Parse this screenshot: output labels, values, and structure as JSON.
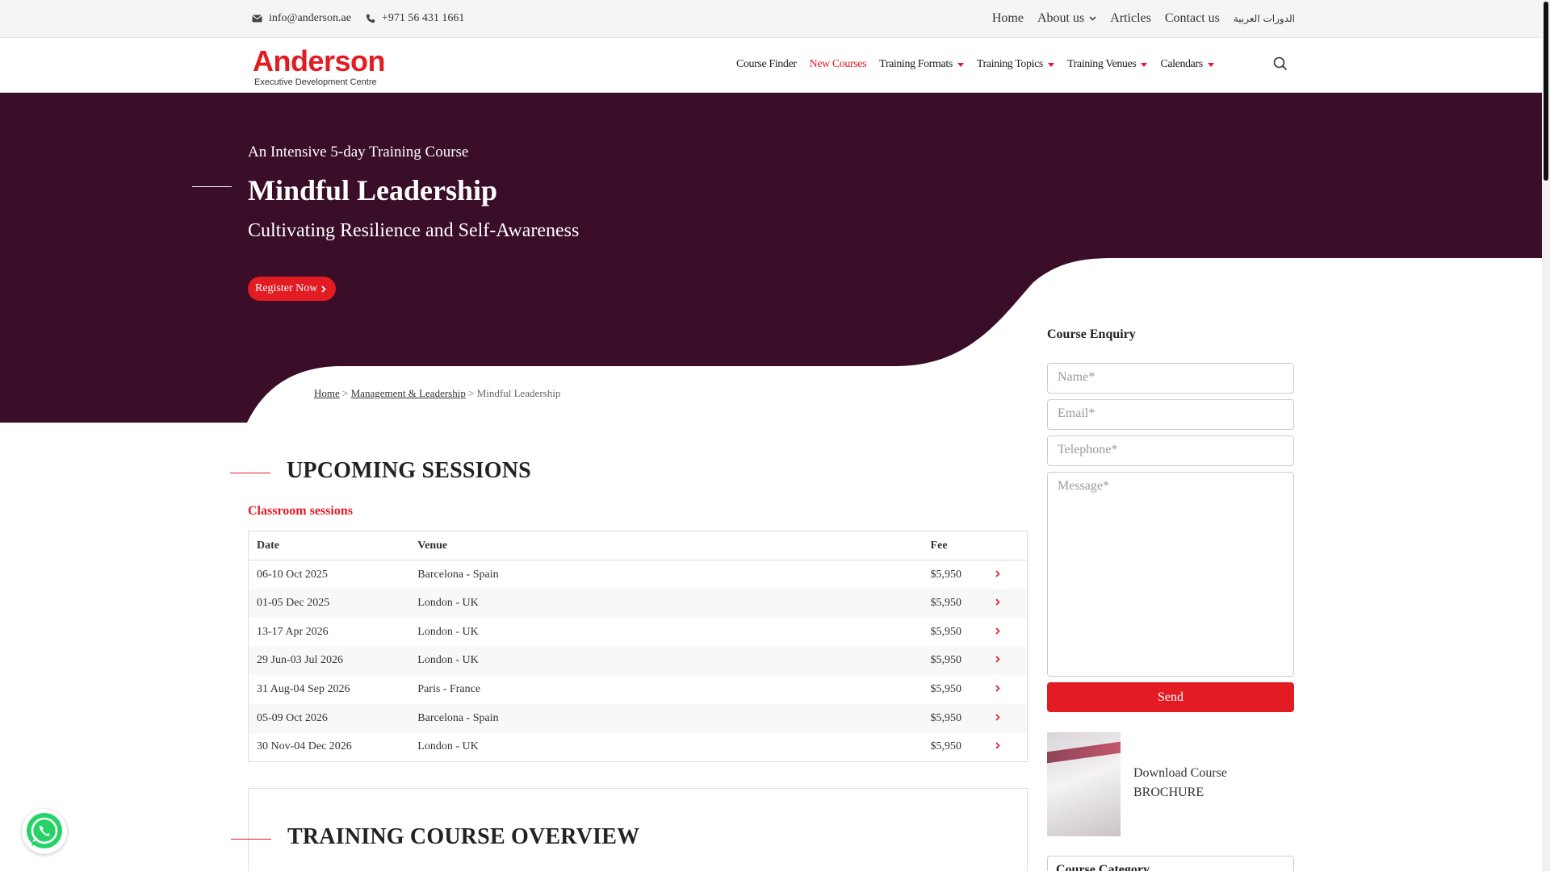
{
  "topbar": {
    "email": "info@anderson.ae",
    "phone": "+971 56 431 1661",
    "links": [
      {
        "label": "Home"
      },
      {
        "label": "About us",
        "dropdown": true
      },
      {
        "label": "Articles"
      },
      {
        "label": "Contact us"
      },
      {
        "label": "الدورات العربية"
      }
    ]
  },
  "logo": {
    "name": "Anderson",
    "tagline": "Executive Development Centre"
  },
  "menu": {
    "items": [
      {
        "label": "Course Finder",
        "active": false,
        "dropdown": false
      },
      {
        "label": "New Courses",
        "active": true,
        "dropdown": false
      },
      {
        "label": "Training Formats",
        "active": false,
        "dropdown": true
      },
      {
        "label": "Training Topics",
        "active": false,
        "dropdown": true
      },
      {
        "label": "Training Venues",
        "active": false,
        "dropdown": true
      },
      {
        "label": "Calendars",
        "active": false,
        "dropdown": true
      }
    ],
    "search_icon": "search-icon"
  },
  "hero": {
    "kicker": "An Intensive 5-day Training Course",
    "title": "Mindful Leadership",
    "subtitle": "Cultivating Resilience and Self-Awareness",
    "register_label": "Register Now",
    "background_color": "#3a0e28"
  },
  "breadcrumb": {
    "home": "Home",
    "sep": ">",
    "category": "Management & Leadership",
    "current": "Mindful Leadership"
  },
  "sessions": {
    "heading": "UPCOMING SESSIONS",
    "subheading": "Classroom sessions",
    "columns": [
      "Date",
      "Venue",
      "Fee"
    ],
    "rows": [
      {
        "date": "06-10 Oct 2025",
        "venue": "Barcelona - Spain",
        "fee": "$5,950"
      },
      {
        "date": "01-05 Dec 2025",
        "venue": "London - UK",
        "fee": "$5,950"
      },
      {
        "date": "13-17 Apr 2026",
        "venue": "London - UK",
        "fee": "$5,950"
      },
      {
        "date": "29 Jun-03 Jul 2026",
        "venue": "London - UK",
        "fee": "$5,950"
      },
      {
        "date": "31 Aug-04 Sep 2026",
        "venue": "Paris - France",
        "fee": "$5,950"
      },
      {
        "date": "05-09 Oct 2026",
        "venue": "Barcelona - Spain",
        "fee": "$5,950"
      },
      {
        "date": "30 Nov-04 Dec 2026",
        "venue": "London - UK",
        "fee": "$5,950"
      }
    ]
  },
  "overview": {
    "heading": "TRAINING COURSE OVERVIEW"
  },
  "enquiry": {
    "title": "Course Enquiry",
    "name_placeholder": "Name*",
    "email_placeholder": "Email*",
    "phone_placeholder": "Telephone*",
    "message_placeholder": "Message*",
    "send_label": "Send"
  },
  "brochure": {
    "line1": "Download Course",
    "line2": "BROCHURE"
  },
  "category": {
    "label": "Course Category"
  },
  "colors": {
    "accent": "#e31b23",
    "hero": "#3a0e28"
  }
}
